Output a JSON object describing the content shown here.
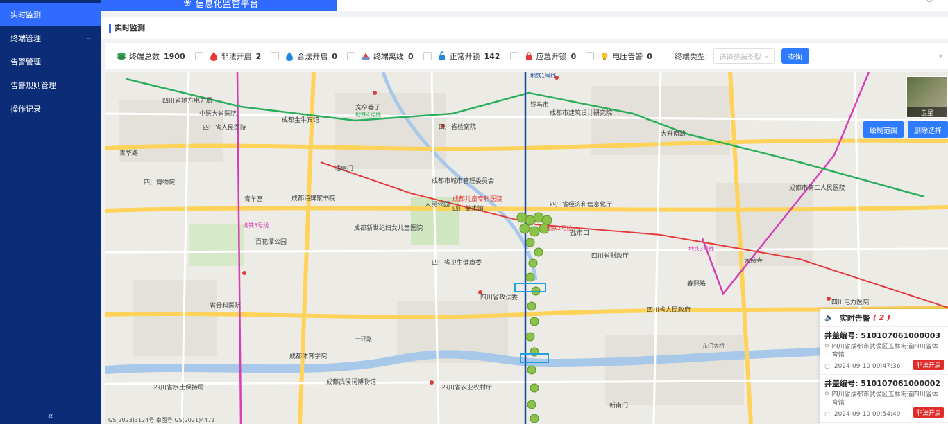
{
  "sidebar": {
    "items": [
      {
        "label": "实时监测",
        "active": true
      },
      {
        "label": "终端管理",
        "has_children": true
      },
      {
        "label": "告警管理"
      },
      {
        "label": "告警规则管理"
      },
      {
        "label": "操作记录"
      }
    ],
    "collapse_icon": "double-chevron-left-icon"
  },
  "topbar": {
    "brand": "信息化监管平台"
  },
  "page": {
    "title": "实时监测"
  },
  "filters": {
    "stats": [
      {
        "label": "终端总数",
        "value": "1900",
        "icon": "stack-icon",
        "color": "#34a853"
      },
      {
        "label": "非法开启",
        "value": "2",
        "icon": "drop-red-icon",
        "color": "#e53935"
      },
      {
        "label": "合法开启",
        "value": "0",
        "icon": "drop-blue-icon",
        "color": "#1e88e5"
      },
      {
        "label": "终端离线",
        "value": "0",
        "icon": "manhole-offline-icon",
        "color": "#7b8cc5"
      },
      {
        "label": "正常开锁",
        "value": "142",
        "icon": "unlock-icon",
        "color": "#1e88e5"
      },
      {
        "label": "应急开锁",
        "value": "0",
        "icon": "lock-red-icon",
        "color": "#e53935"
      },
      {
        "label": "电压告警",
        "value": "0",
        "icon": "bulb-icon",
        "color": "#fbc02d"
      }
    ],
    "type_label": "终端类型:",
    "type_placeholder": "选择终端类型",
    "query_label": "查询"
  },
  "map": {
    "draw_label": "绘制范围",
    "clear_label": "删除选择",
    "satellite_label": "卫星",
    "copyright": "GS(2023)3124号 审图号 GS(2021)4471",
    "labels": [
      "四川省地方电力局",
      "中医大省医院",
      "四川省人民医院",
      "成都金牛宾馆",
      "宽窄巷子",
      "四川省检察院",
      "镋马市",
      "成都市建筑设计研究院",
      "大升南路",
      "青华路",
      "四川博物院",
      "成都诗婢家书院",
      "青羊宫",
      "通惠门",
      "成都市城市管理委员会",
      "成都儿童专科医院",
      "人民公园",
      "四川美术馆",
      "四川省经济和信息化厅",
      "成都新世纪妇女儿童医院",
      "盐市口",
      "百花潭公园",
      "四川省卫生健康委",
      "四川省政法委",
      "四川省人民政府",
      "春熙路",
      "四川电力医院",
      "省骨科医院",
      "成都体育学院",
      "四川省水土保持局",
      "成都武侯祠博物馆",
      "成都市第二人民医院",
      "四川省农业农村厅",
      "新南门",
      "一环路",
      "四川省财政厅",
      "大慈寺",
      "东门大桥",
      "地铁1号线",
      "地铁2号线",
      "地铁3号线",
      "地铁4号线",
      "地铁5号线"
    ]
  },
  "alarms": {
    "title": "实时告警",
    "count": "( 2 )",
    "items": [
      {
        "no_label": "井盖编号:",
        "no": "510107061000003",
        "address": "四川省成都市武侯区玉林街道四川省体育馆",
        "time": "2024-09-10 09:47:36",
        "tag": "非法开启"
      },
      {
        "no_label": "井盖编号:",
        "no": "510107061000002",
        "address": "四川省成都市武侯区玉林街道四川省体育馆",
        "time": "2024-09-10 09:54:49",
        "tag": "非法开启"
      }
    ]
  }
}
